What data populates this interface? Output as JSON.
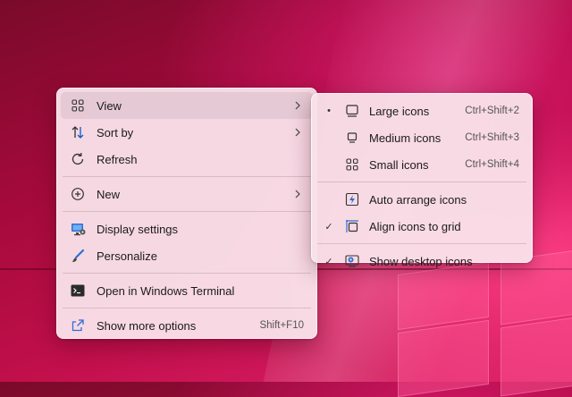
{
  "main_menu": {
    "items": [
      {
        "label": "View",
        "icon": "grid-icon"
      },
      {
        "label": "Sort by",
        "icon": "sort-arrows-icon"
      },
      {
        "label": "Refresh",
        "icon": "refresh-icon"
      },
      {
        "label": "New",
        "icon": "plus-circle-icon"
      },
      {
        "label": "Display settings",
        "icon": "display-icon"
      },
      {
        "label": "Personalize",
        "icon": "brush-icon"
      },
      {
        "label": "Open in Windows Terminal",
        "icon": "terminal-icon"
      },
      {
        "label": "Show more options",
        "icon": "share-out-icon",
        "shortcut": "Shift+F10"
      }
    ]
  },
  "view_submenu": {
    "items": [
      {
        "label": "Large icons",
        "shortcut": "Ctrl+Shift+2",
        "selected": true,
        "icon": "large-icons-icon"
      },
      {
        "label": "Medium icons",
        "shortcut": "Ctrl+Shift+3",
        "selected": false,
        "icon": "medium-icons-icon"
      },
      {
        "label": "Small icons",
        "shortcut": "Ctrl+Shift+4",
        "selected": false,
        "icon": "small-icons-icon"
      },
      {
        "label": "Auto arrange icons",
        "checked": false,
        "icon": "auto-arrange-icon"
      },
      {
        "label": "Align icons to grid",
        "checked": true,
        "icon": "align-grid-icon"
      },
      {
        "label": "Show desktop icons",
        "checked": true,
        "icon": "show-desktop-icon"
      }
    ],
    "bullet": "•",
    "check": "✓"
  },
  "colors": {
    "menu_bg": "#f9e1e9",
    "hover_bg": "#d7bec8",
    "accent": "#0a5ccb",
    "text": "#1b1b1b"
  }
}
